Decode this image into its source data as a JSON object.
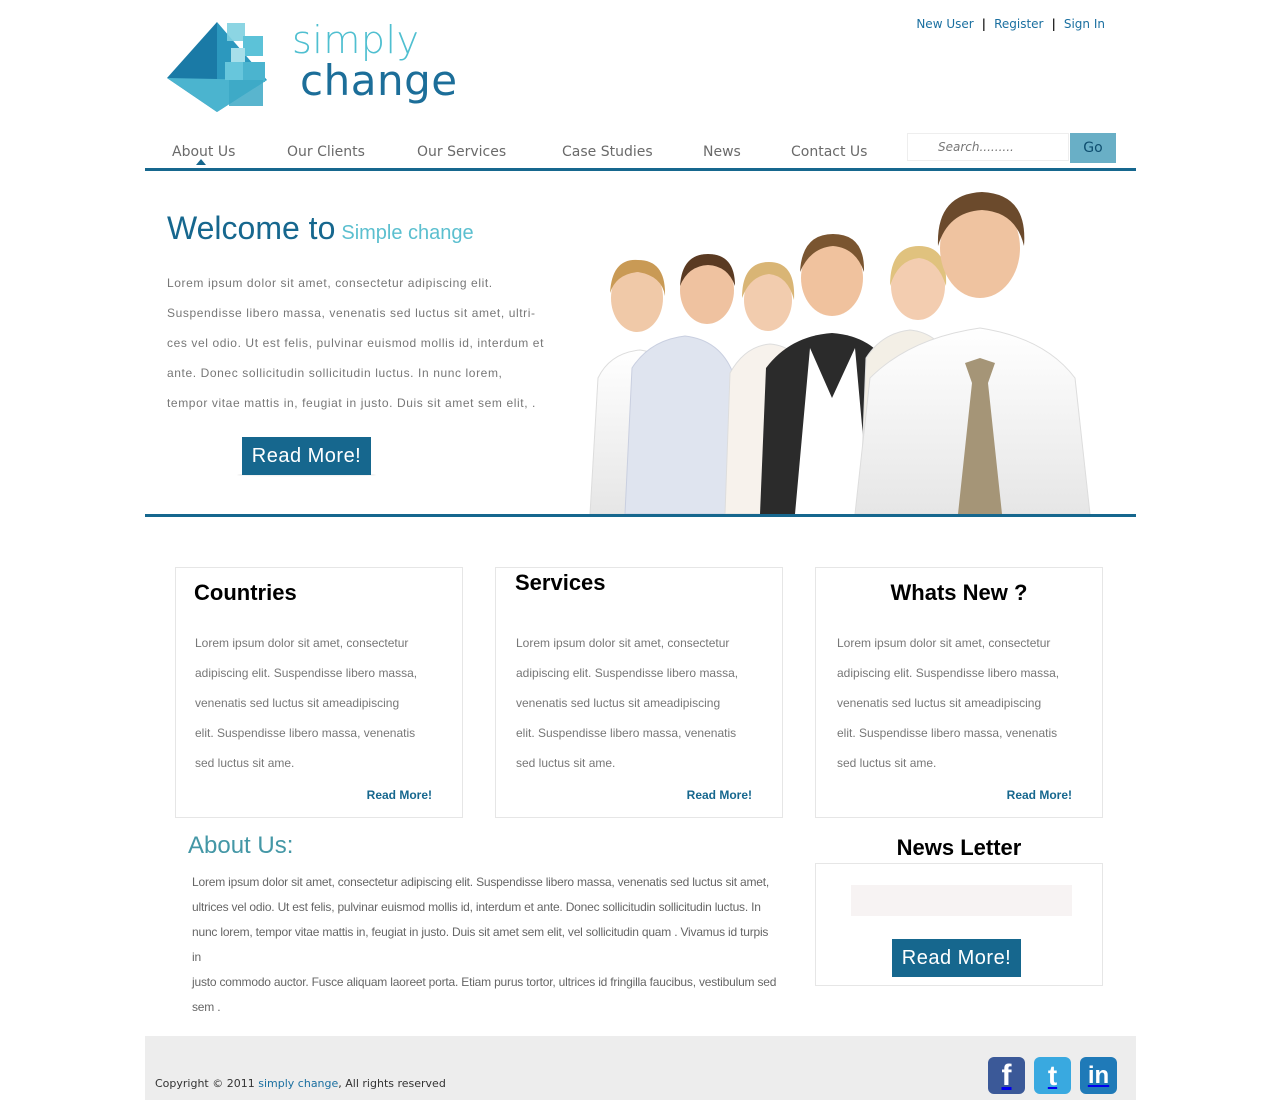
{
  "logo": {
    "word1": "simply",
    "word2": "change"
  },
  "top_links": {
    "new_user": "New User",
    "register": "Register",
    "sign_in": "Sign In",
    "sep": "|"
  },
  "nav": {
    "items": [
      "About Us",
      "Our Clients",
      "Our Services",
      "Case Studies",
      "News",
      "Contact Us"
    ],
    "active": "About Us",
    "search_placeholder": "Search.........",
    "go_label": "Go"
  },
  "hero": {
    "welcome": "Welcome to",
    "welcome_sub": "Simple change",
    "lines": [
      "Lorem ipsum dolor sit amet, consectetur adipiscing elit.",
      "Suspendisse libero massa, venenatis sed luctus sit amet, ultri-",
      "ces vel odio. Ut est felis, pulvinar euismod mollis id, interdum et",
      "ante. Donec sollicitudin sollicitudin luctus. In nunc lorem,",
      "tempor vitae mattis in, feugiat in justo. Duis sit amet sem elit, ."
    ],
    "button": "Read More!"
  },
  "boxes": [
    {
      "title": "Countries",
      "lines": [
        "Lorem   ipsum   dolor sit amet, consectetur",
        "adipiscing elit. Suspendisse libero massa,",
        " venenatis  sed  luctus   sit  ameadipiscing",
        "elit. Suspendisse libero massa, venenatis",
        " sed luctus sit ame."
      ],
      "more": "Read More!"
    },
    {
      "title": "Services",
      "lines": [
        "Lorem   ipsum   dolor sit amet, consectetur",
        "adipiscing elit. Suspendisse libero massa,",
        " venenatis  sed  luctus   sit  ameadipiscing",
        "elit. Suspendisse libero massa, venenatis",
        " sed luctus sit ame."
      ],
      "more": "Read More!"
    },
    {
      "title": "Whats New ?",
      "lines": [
        "Lorem   ipsum   dolor sit amet, consectetur",
        "adipiscing elit. Suspendisse libero massa,",
        " venenatis  sed  luctus   sit  ameadipiscing",
        "elit. Suspendisse libero massa, venenatis",
        " sed luctus sit ame."
      ],
      "more": "Read More!"
    }
  ],
  "about": {
    "title": "About Us:",
    "lines": [
      "Lorem ipsum dolor sit amet, consectetur adipiscing elit. Suspendisse libero massa, venenatis sed luctus sit amet,",
      "ultrices vel odio. Ut est felis, pulvinar euismod mollis id, interdum et ante. Donec sollicitudin sollicitudin luctus. In",
      "nunc lorem, tempor vitae mattis in, feugiat in justo. Duis sit amet sem elit, vel sollicitudin quam . Vivamus id turpis in",
      "justo commodo auctor. Fusce aliquam laoreet porta. Etiam purus tortor, ultrices id fringilla faucibus, vestibulum sed",
      "sem ."
    ]
  },
  "newsletter": {
    "title": "News Letter",
    "button": "Read More!"
  },
  "footer": {
    "copy_prefix": "Copyright © 2011",
    "brand": "simply change",
    "copy_suffix": ", All rights reserved"
  },
  "social": [
    {
      "name": "facebook",
      "glyph": "f",
      "color": "#3b5998"
    },
    {
      "name": "twitter",
      "glyph": "t",
      "color": "#39a9e0"
    },
    {
      "name": "linkedin",
      "glyph": "in",
      "color": "#1f7ab8"
    }
  ],
  "colors": {
    "brand_dark": "#16678e",
    "brand_light": "#5bbfcf",
    "go_button": "#69afc6",
    "footer_bg": "#ededed"
  }
}
